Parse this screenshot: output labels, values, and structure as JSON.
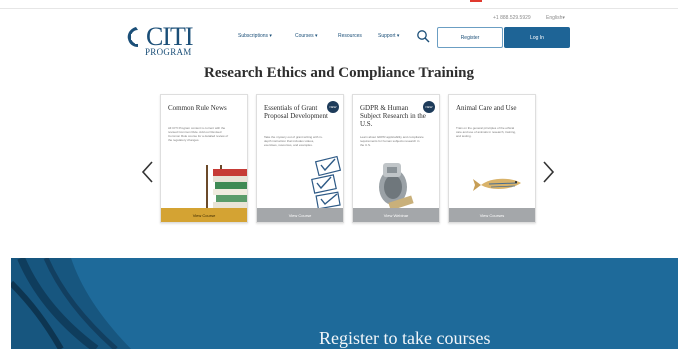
{
  "utility": {
    "phone": "+1 888.529.5929",
    "language": "English"
  },
  "brand": {
    "logo_main": "CITI",
    "logo_sub": "PROGRAM"
  },
  "nav": {
    "items": [
      {
        "label": "Subscriptions",
        "has_dropdown": true
      },
      {
        "label": "Courses",
        "has_dropdown": true
      },
      {
        "label": "Resources",
        "has_dropdown": false
      },
      {
        "label": "Support",
        "has_dropdown": true
      }
    ],
    "icons": [
      "search-icon"
    ],
    "register_label": "Register",
    "login_label": "Log In"
  },
  "hero": {
    "headline": "Research Ethics and Compliance Training"
  },
  "carousel": {
    "icons": [
      "chevron-left-icon",
      "chevron-right-icon"
    ],
    "cards": [
      {
        "title": "Common Rule News",
        "description": "All CITI Program content is current with the revised Common Rule. Add our Revised Common Rule course for a detailed review of the regulatory changes.",
        "button": "View Course",
        "badge": "",
        "image": "books-illustration"
      },
      {
        "title": "Essentials of Grant Proposal Development",
        "description": "Take the mystery out of grant writing with in-depth instruction that includes videos, exercises, resources, and examples.",
        "button": "View Course",
        "badge": "NEW",
        "image": "checklist-illustration"
      },
      {
        "title": "GDPR & Human Subject Research in the U.S.",
        "description": "Learn about GDPR applicability and compliance requirements for human subjects research in the U.S.",
        "button": "View Webinar",
        "badge": "NEW",
        "image": "padlock-illustration"
      },
      {
        "title": "Animal Care and Use",
        "description": "Train on the general principles of the ethical care and use of animals in research, training, and testing.",
        "button": "View Courses",
        "badge": "",
        "image": "zebrafish-illustration"
      }
    ]
  },
  "banner": {
    "text": "Register to take courses"
  },
  "colors": {
    "brand_blue": "#1b4f78",
    "login_button": "#1e6496",
    "banner": "#1e6a9a",
    "gold_button": "#d4a333",
    "gray_button": "#a4a7aa",
    "badge": "#1d3b5a",
    "accent_red": "#e03a2f"
  }
}
